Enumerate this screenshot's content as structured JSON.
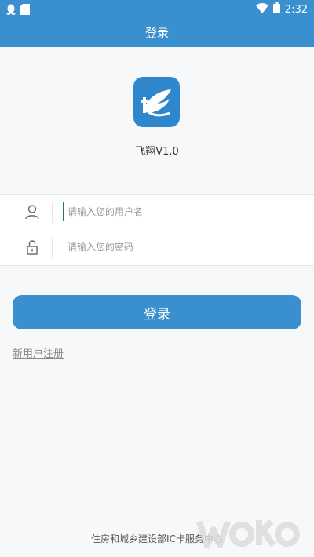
{
  "status_bar": {
    "time": "2:32",
    "left_icons": [
      "qq-penguin-icon",
      "sim-card-icon"
    ],
    "right_icons": [
      "wifi-icon",
      "battery-icon"
    ]
  },
  "app_bar": {
    "title": "登录"
  },
  "logo": {
    "icon": "feather-logo-icon",
    "color": "#2e86cc"
  },
  "app_name": "飞翔V1.0",
  "form": {
    "username_placeholder": "请输入您的用户名",
    "username_value": "",
    "password_placeholder": "请输入您的密码",
    "password_value": "",
    "user_icon": "user-icon",
    "lock_icon": "unlock-icon"
  },
  "login_button": "登录",
  "register_link": "新用户注册",
  "footer": "住房和城乡建设部IC卡服务中心",
  "colors": {
    "primary": "#3a8fce",
    "background": "#f7f8f9"
  }
}
